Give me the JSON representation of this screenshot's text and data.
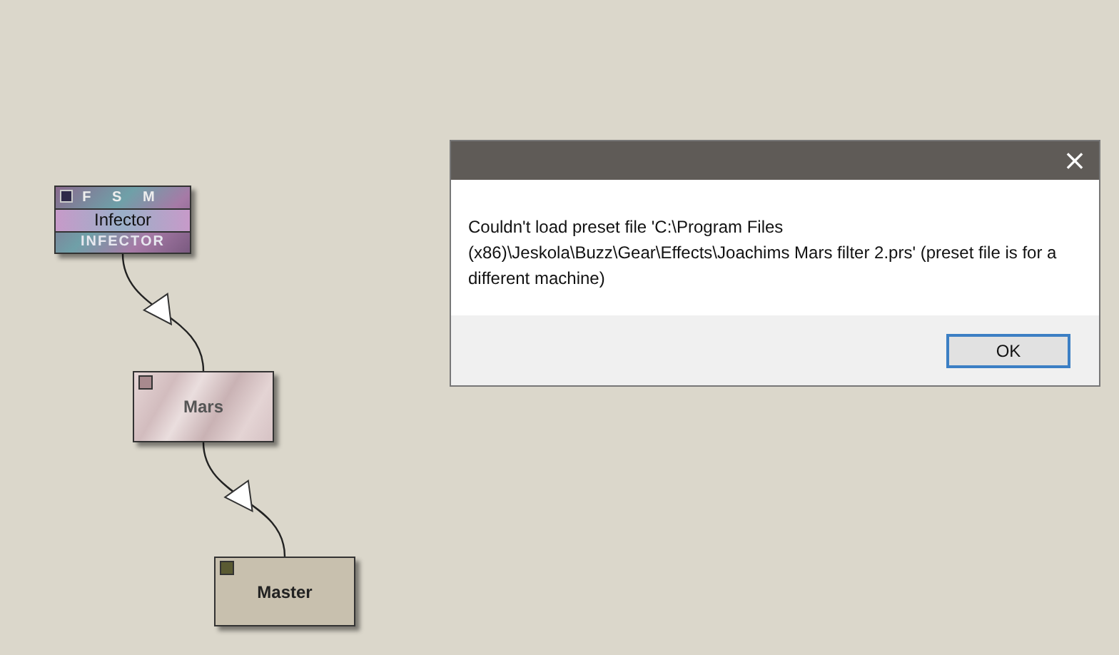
{
  "machines": [
    {
      "kind": "generator",
      "header": "F S M",
      "name": "Infector",
      "logo": "INFECTOR",
      "outputs": [
        {
          "kind": "effect",
          "name": "Mars",
          "outputs": [
            {
              "kind": "master",
              "name": "Master"
            }
          ]
        }
      ]
    }
  ],
  "dialog": {
    "message": "Couldn't load preset file 'C:\\Program Files (x86)\\Jeskola\\Buzz\\Gear\\Effects\\Joachims Mars filter 2.prs' (preset file is for a different machine)",
    "close": "×",
    "buttons": [
      "OK"
    ]
  }
}
